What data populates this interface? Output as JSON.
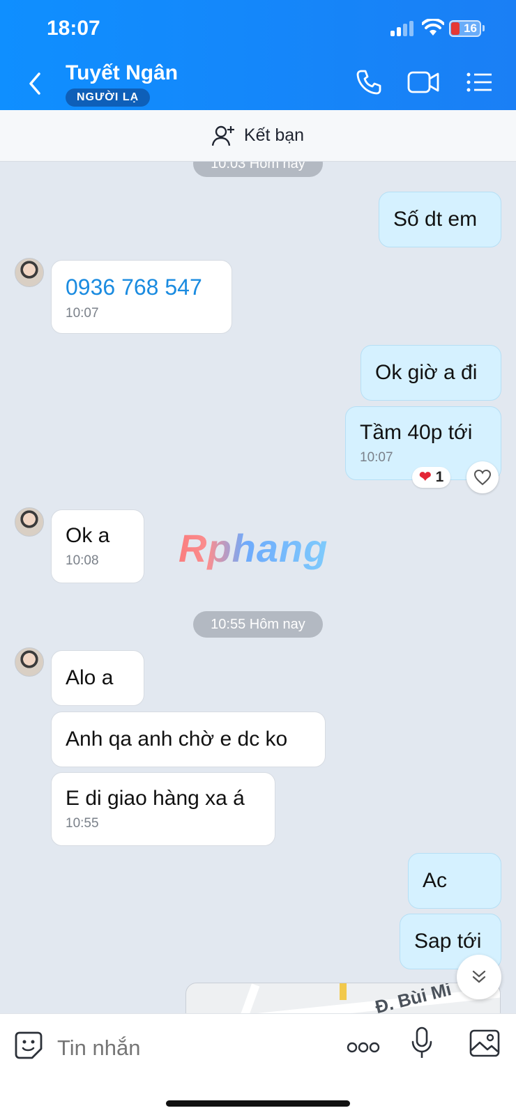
{
  "status": {
    "time": "18:07",
    "battery": "16"
  },
  "header": {
    "contact_name": "Tuyết Ngân",
    "badge": "NGƯỜI LẠ"
  },
  "friend_bar": {
    "label": "Kết bạn"
  },
  "messages": {
    "divider1": "10:03 Hôm nay",
    "m1": "Số dt em",
    "m2_phone": "0936 768 547",
    "m2_time": "10:07",
    "m3": "Ok giờ a đi",
    "m4": "Tầm 40p tới",
    "m4_time": "10:07",
    "m4_reaction_count": "1",
    "m5": "Ok a",
    "m5_time": "10:08",
    "watermark": "Rphang",
    "divider2": "10:55 Hôm nay",
    "m6": "Alo a",
    "m7": "Anh qa anh chờ e dc ko",
    "m8": "E di giao hàng xa á",
    "m8_time": "10:55",
    "m9": "Ac",
    "m10": "Sap tới",
    "map_street": "Đ. Bùi Mi"
  },
  "input": {
    "placeholder": "Tin nhắn"
  },
  "colors": {
    "header": "#1a7ff5",
    "outgoing": "#d5f1ff",
    "incoming": "#ffffff",
    "link": "#1a8be0"
  }
}
